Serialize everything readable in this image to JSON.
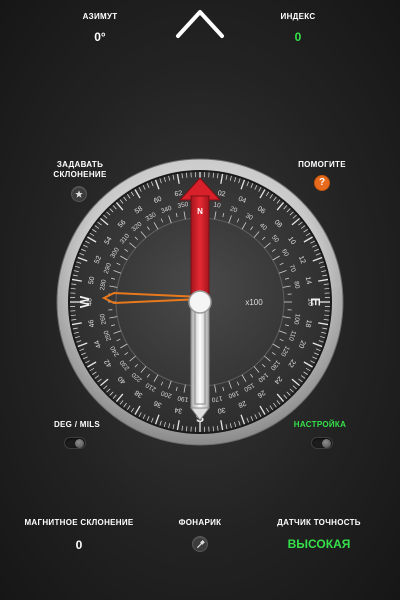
{
  "top": {
    "azimuth": {
      "label": "АЗИМУТ",
      "value": "0°"
    },
    "index": {
      "label": "ИНДЕКС",
      "value": "0"
    }
  },
  "left_button": {
    "label_line1": "ЗАДАВАТЬ",
    "label_line2": "СКЛОНЕНИЕ",
    "icon": "star-icon"
  },
  "right_button": {
    "label": "ПОМОГИТЕ",
    "icon": "question-icon"
  },
  "compass": {
    "heading_degrees": 0,
    "cardinals": [
      "N",
      "E",
      "S",
      "W"
    ],
    "center_label": "x100",
    "needle_label": "N",
    "bezel_numbers": [
      "02",
      "04",
      "06",
      "08",
      "10",
      "12",
      "14",
      "16",
      "18",
      "20",
      "22",
      "24",
      "26",
      "28",
      "30",
      "32",
      "34",
      "36",
      "38",
      "40",
      "42",
      "44",
      "46",
      "48",
      "50",
      "52",
      "54",
      "56",
      "58",
      "60",
      "62"
    ],
    "inner_numbers": [
      "10",
      "20",
      "30",
      "40",
      "50",
      "60",
      "70",
      "80",
      "100",
      "110",
      "120",
      "130",
      "140",
      "150",
      "160",
      "170",
      "190",
      "200",
      "210",
      "220",
      "230",
      "240",
      "250",
      "260",
      "280",
      "290",
      "300",
      "310",
      "320",
      "330",
      "340",
      "350"
    ]
  },
  "mode_toggle": {
    "label": "DEG / MILS"
  },
  "settings_toggle": {
    "label": "НАСТРОЙКА",
    "color": "#35e04a"
  },
  "bottom": {
    "magnetic_declination": {
      "label": "МАГНИТНОЕ СКЛОНЕНИЕ",
      "value": "0"
    },
    "flashlight": {
      "label": "ФОНАРИК",
      "icon": "flashlight-icon"
    },
    "sensor_accuracy": {
      "label": "ДАТЧИК ТОЧНОСТЬ",
      "value": "ВЫСОКАЯ",
      "color": "#35e04a"
    }
  },
  "colors": {
    "accent_green": "#35e04a",
    "needle_red": "#d8202a",
    "help_orange": "#e86a1c",
    "pointer_orange": "#e8781c"
  }
}
